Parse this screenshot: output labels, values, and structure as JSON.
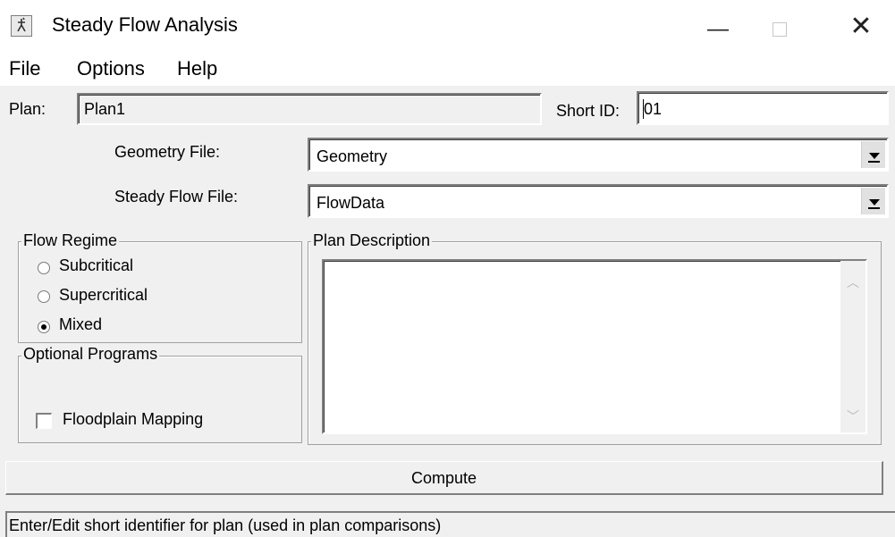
{
  "window": {
    "title": "Steady Flow Analysis",
    "minimize_glyph": "—",
    "close_glyph": "✕",
    "icon": "app-runner-icon"
  },
  "menu": {
    "items": [
      "File",
      "Options",
      "Help"
    ]
  },
  "plan": {
    "label": "Plan:",
    "value": "Plan1",
    "short_id_label": "Short ID:",
    "short_id_value": "01"
  },
  "files": {
    "geometry_label": "Geometry File:",
    "geometry_value": "Geometry",
    "flow_label": "Steady Flow File:",
    "flow_value": "FlowData"
  },
  "flow_regime": {
    "title": "Flow Regime",
    "options": [
      {
        "label": "Subcritical",
        "checked": false
      },
      {
        "label": "Supercritical",
        "checked": false
      },
      {
        "label": "Mixed",
        "checked": true
      }
    ]
  },
  "optional_programs": {
    "title": "Optional Programs",
    "floodplain_label": "Floodplain Mapping",
    "floodplain_checked": false
  },
  "description": {
    "title": "Plan Description",
    "value": ""
  },
  "actions": {
    "compute_label": "Compute"
  },
  "status": {
    "text": "Enter/Edit short identifier for plan (used in plan comparisons)"
  }
}
